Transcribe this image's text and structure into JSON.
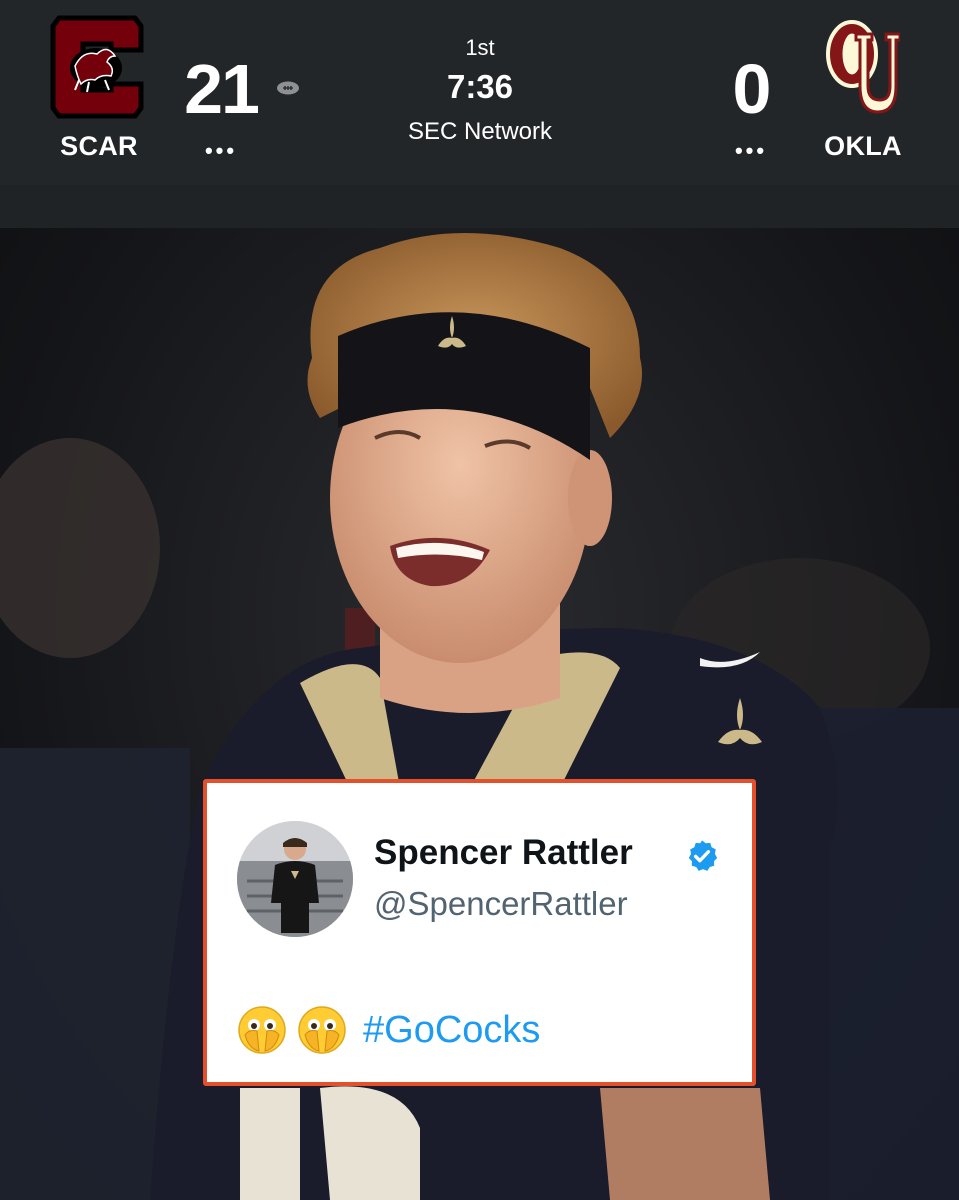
{
  "scoreboard": {
    "home": {
      "abbr": "SCAR",
      "score": "21",
      "more": "•••"
    },
    "away": {
      "abbr": "OKLA",
      "score": "0",
      "more": "•••"
    },
    "period": "1st",
    "clock": "7:36",
    "network": "SEC Network",
    "possession_icon": "football-icon"
  },
  "tweet": {
    "name": "Spencer Rattler",
    "handle": "@SpencerRattler",
    "verified_icon": "verified-badge-icon",
    "emojis": [
      "face-with-open-eyes-and-hand-over-mouth",
      "face-with-open-eyes-and-hand-over-mouth"
    ],
    "hashtag": "#GoCocks"
  },
  "colors": {
    "scoreboard_bg": "#232629",
    "card_border": "#e4502c",
    "hashtag": "#1d9bf0",
    "verified": "#1d9bf0",
    "home_primary": "#73000a",
    "away_primary": "#841617",
    "away_logo_fill": "#fdf9d8"
  }
}
